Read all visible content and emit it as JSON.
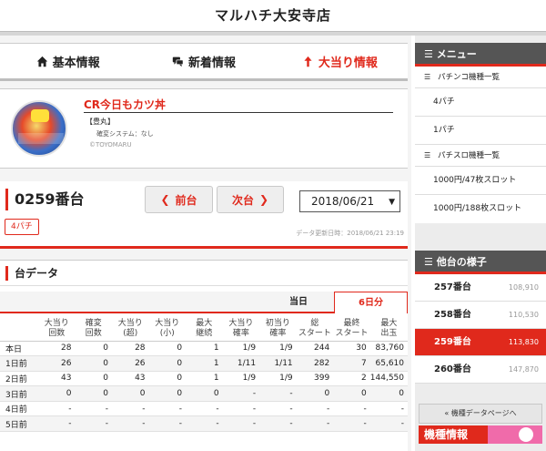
{
  "header": {
    "title": "マルハチ大安寺店"
  },
  "nav": {
    "items": [
      {
        "label": "基本情報",
        "icon": "home-icon",
        "active": false
      },
      {
        "label": "新着情報",
        "icon": "chat-icon",
        "active": false
      },
      {
        "label": "大当り情報",
        "icon": "up-arrow-icon",
        "active": true
      }
    ]
  },
  "machine": {
    "name": "CR今日もカツ丼",
    "maker": "【豊丸】",
    "kakuhen": "確変システム：なし",
    "copyright": "©TOYOMARU"
  },
  "unit": {
    "number": "0259番台",
    "prev_label": "前台",
    "next_label": "次台",
    "date": "2018/06/21",
    "tag": "4パチ",
    "updated": "データ更新日時：2018/06/21 23:19"
  },
  "data_card": {
    "title": "台データ",
    "tab_today": "当日",
    "tab_6days": "6日分",
    "columns": [
      [
        "",
        ""
      ],
      [
        "大当り",
        "回数"
      ],
      [
        "確変",
        "回数"
      ],
      [
        "大当り",
        "(超)"
      ],
      [
        "大当り",
        "(小)"
      ],
      [
        "最大",
        "継続"
      ],
      [
        "大当り",
        "確率"
      ],
      [
        "初当り",
        "確率"
      ],
      [
        "総",
        "スタート"
      ],
      [
        "最終",
        "スタート"
      ],
      [
        "最大",
        "出玉"
      ]
    ],
    "rows": [
      [
        "本日",
        "28",
        "0",
        "28",
        "0",
        "1",
        "1/9",
        "1/9",
        "244",
        "30",
        "83,760"
      ],
      [
        "1日前",
        "26",
        "0",
        "26",
        "0",
        "1",
        "1/11",
        "1/11",
        "282",
        "7",
        "65,610"
      ],
      [
        "2日前",
        "43",
        "0",
        "43",
        "0",
        "1",
        "1/9",
        "1/9",
        "399",
        "2",
        "144,550"
      ],
      [
        "3日前",
        "0",
        "0",
        "0",
        "0",
        "0",
        "-",
        "-",
        "0",
        "0",
        "0"
      ],
      [
        "4日前",
        "-",
        "-",
        "-",
        "-",
        "-",
        "-",
        "-",
        "-",
        "-",
        "-"
      ],
      [
        "5日前",
        "-",
        "-",
        "-",
        "-",
        "-",
        "-",
        "-",
        "-",
        "-",
        "-"
      ]
    ]
  },
  "menu": {
    "title": "メニュー",
    "pachinko_header": "パチンコ機種一覧",
    "pachinko_items": [
      "4パチ",
      "1パチ"
    ],
    "slot_header": "パチスロ機種一覧",
    "slot_items": [
      "1000円/47枚スロット",
      "1000円/188枚スロット"
    ]
  },
  "others": {
    "title": "他台の様子",
    "rows": [
      {
        "name": "257番台",
        "value": "108,910",
        "active": false
      },
      {
        "name": "258番台",
        "value": "110,530",
        "active": false
      },
      {
        "name": "259番台",
        "value": "113,830",
        "active": true
      },
      {
        "name": "260番台",
        "value": "147,870",
        "active": false
      }
    ],
    "back_label": "« 機種データページへ",
    "banner_label": "機種情報"
  },
  "colors": {
    "accent": "#e0291c",
    "panel_header": "#555555"
  }
}
